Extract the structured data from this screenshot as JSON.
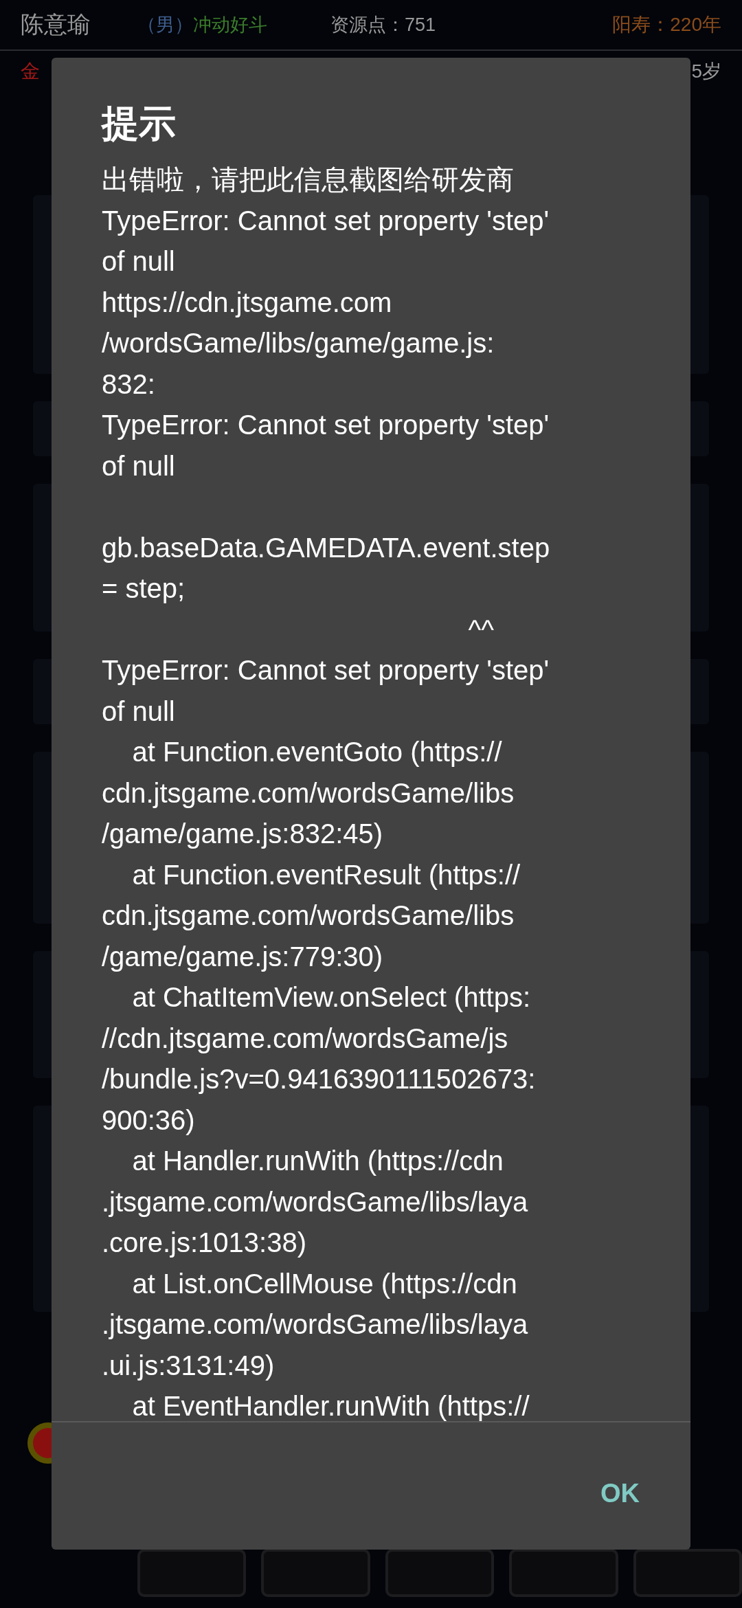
{
  "background": {
    "player_name": "陈意瑜",
    "gender": "（男）",
    "trait": "冲动好斗",
    "resources": "资源点：751",
    "lifespan": "阳寿：220年",
    "realm": "金",
    "age": "5岁"
  },
  "dialog": {
    "title": "提示",
    "message": "出错啦，请把此信息截图给研发商\nTypeError: Cannot set property 'step'\nof null\nhttps://cdn.jtsgame.com\n/wordsGame/libs/game/game.js:\n832:\nTypeError: Cannot set property 'step'\nof null\n\ngb.baseData.GAMEDATA.event.step\n= step;\n                                                ^^\nTypeError: Cannot set property 'step'\nof null\n    at Function.eventGoto (https://\ncdn.jtsgame.com/wordsGame/libs\n/game/game.js:832:45)\n    at Function.eventResult (https://\ncdn.jtsgame.com/wordsGame/libs\n/game/game.js:779:30)\n    at ChatItemView.onSelect (https:\n//cdn.jtsgame.com/wordsGame/js\n/bundle.js?v=0.9416390111502673:\n900:36)\n    at Handler.runWith (https://cdn\n.jtsgame.com/wordsGame/libs/laya\n.core.js:1013:38)\n    at List.onCellMouse (https://cdn\n.jtsgame.com/wordsGame/libs/laya\n.ui.js:3131:49)\n    at EventHandler.runWith (https://",
    "buttons": [
      "OK"
    ]
  }
}
